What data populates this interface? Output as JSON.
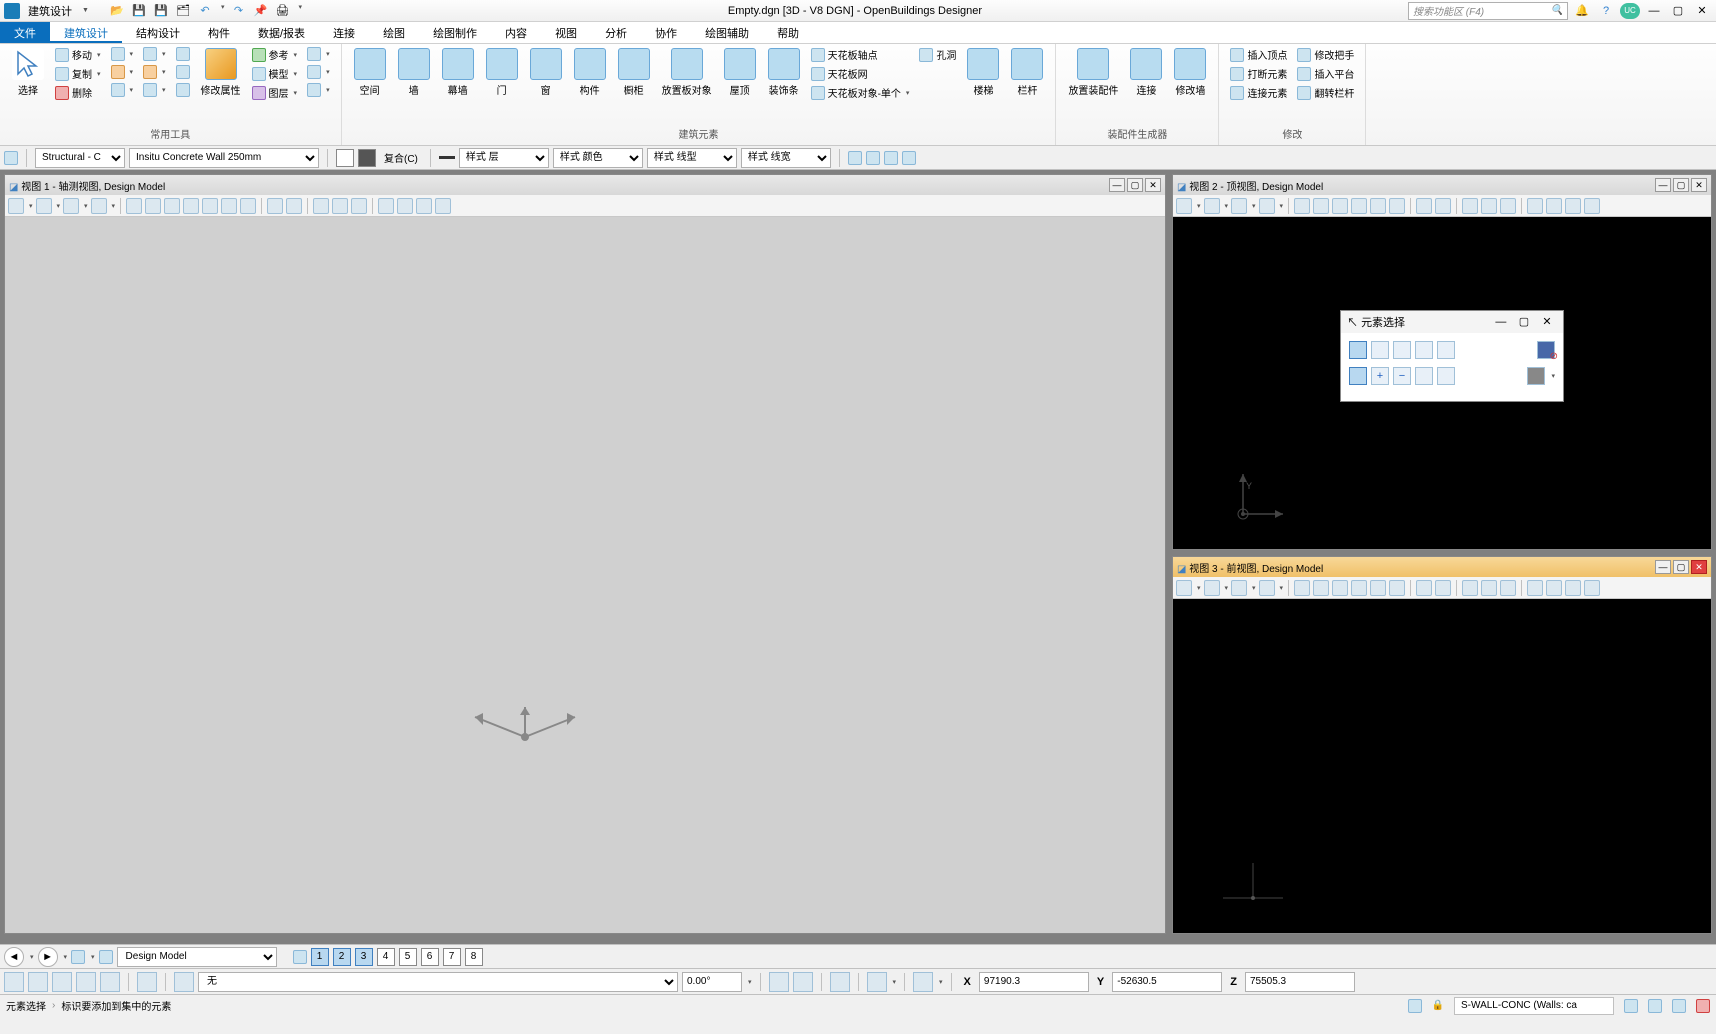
{
  "titlebar": {
    "workflow": "建筑设计",
    "title": "Empty.dgn [3D - V8 DGN] - OpenBuildings Designer",
    "search_placeholder": "搜索功能区 (F4)"
  },
  "tabs": {
    "file": "文件",
    "items": [
      "建筑设计",
      "结构设计",
      "构件",
      "数据/报表",
      "连接",
      "绘图",
      "绘图制作",
      "内容",
      "视图",
      "分析",
      "协作",
      "绘图辅助",
      "帮助"
    ],
    "active": "建筑设计"
  },
  "ribbon": {
    "group_common": {
      "label": "常用工具",
      "select": "选择",
      "move": "移动",
      "copy": "复制",
      "delete": "删除",
      "attrs": "修改属性",
      "ref": "参考",
      "model": "模型",
      "layer": "图层"
    },
    "group_building": {
      "label": "建筑元素",
      "space": "空间",
      "wall": "墙",
      "curtain": "幕墙",
      "door": "门",
      "window": "窗",
      "assembly": "构件",
      "cabinet": "橱柜",
      "place_plate": "放置板对象",
      "roof": "屋顶",
      "decor": "装饰条",
      "ceiling_axis": "天花板轴点",
      "ceiling_grid": "天花板网",
      "ceiling_single": "天花板对象-单个",
      "hole": "孔洞",
      "stair": "楼梯",
      "railing": "栏杆"
    },
    "group_assembly": {
      "label": "装配件生成器",
      "place_assembly": "放置装配件",
      "connect": "连接",
      "modify_wall": "修改墙"
    },
    "group_modify": {
      "label": "修改",
      "insert_vertex": "插入顶点",
      "break_elem": "打断元素",
      "connect_elem": "连接元素",
      "modify_handle": "修改把手",
      "insert_platform": "插入平台",
      "flip_railing": "翻转栏杆"
    }
  },
  "attr_bar": {
    "family": "Structural - C",
    "part": "Insitu Concrete Wall 250mm",
    "compound": "复合(C)",
    "style_layer": "样式 层",
    "style_color": "样式 颜色",
    "style_line": "样式 线型",
    "style_weight": "样式 线宽"
  },
  "views": {
    "v1": {
      "title": "视图 1 - 轴测视图, Design Model"
    },
    "v2": {
      "title": "视图 2 - 顶视图, Design Model"
    },
    "v3": {
      "title": "视图 3 - 前视图, Design Model"
    }
  },
  "elem_select": {
    "title": "元素选择"
  },
  "nav_bar": {
    "model": "Design Model",
    "views": [
      "1",
      "2",
      "3",
      "4",
      "5",
      "6",
      "7",
      "8"
    ],
    "active_views": [
      "1",
      "2",
      "3"
    ]
  },
  "accu_bar": {
    "none_label": "无",
    "angle": "0.00°",
    "x": "97190.3",
    "y": "-52630.5",
    "z": "75505.3"
  },
  "status": {
    "tool": "元素选择",
    "prompt": "标识要添加到集中的元素",
    "level": "S-WALL-CONC (Walls: ca"
  }
}
